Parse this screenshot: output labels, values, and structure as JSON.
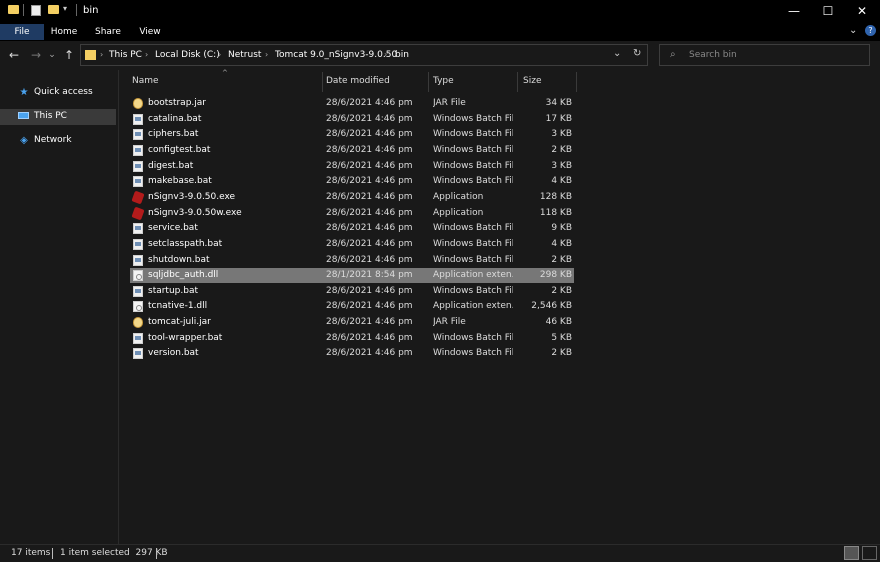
{
  "window": {
    "title": "bin",
    "min_glyph": "—",
    "max_glyph": "☐",
    "close_glyph": "✕"
  },
  "ribbon": {
    "tabs": [
      "File",
      "Home",
      "Share",
      "View"
    ],
    "expand_glyph": "⌄",
    "help_glyph": "?"
  },
  "address": {
    "crumbs": [
      "This PC",
      "Local Disk (C:)",
      "Netrust",
      "Tomcat 9.0_nSignv3-9.0.50",
      "bin"
    ],
    "separator": "›"
  },
  "search": {
    "placeholder": "Search bin"
  },
  "nav": {
    "back": "←",
    "forward": "→",
    "recent": "⌄",
    "up": "↑",
    "refresh": "↻",
    "dropdown": "⌄",
    "items": [
      {
        "label": "Quick access",
        "icon": "star-icon",
        "selected": false
      },
      {
        "label": "This PC",
        "icon": "computer-icon",
        "selected": true
      },
      {
        "label": "Network",
        "icon": "network-icon",
        "selected": false
      }
    ]
  },
  "columns": {
    "name": "Name",
    "date": "Date modified",
    "type": "Type",
    "size": "Size"
  },
  "files": [
    {
      "name": "bootstrap.jar",
      "date": "28/6/2021 4:46 pm",
      "type": "JAR File",
      "size": "34 KB",
      "icon": "jar"
    },
    {
      "name": "catalina.bat",
      "date": "28/6/2021 4:46 pm",
      "type": "Windows Batch File",
      "size": "17 KB",
      "icon": "bat"
    },
    {
      "name": "ciphers.bat",
      "date": "28/6/2021 4:46 pm",
      "type": "Windows Batch File",
      "size": "3 KB",
      "icon": "bat"
    },
    {
      "name": "configtest.bat",
      "date": "28/6/2021 4:46 pm",
      "type": "Windows Batch File",
      "size": "2 KB",
      "icon": "bat"
    },
    {
      "name": "digest.bat",
      "date": "28/6/2021 4:46 pm",
      "type": "Windows Batch File",
      "size": "3 KB",
      "icon": "bat"
    },
    {
      "name": "makebase.bat",
      "date": "28/6/2021 4:46 pm",
      "type": "Windows Batch File",
      "size": "4 KB",
      "icon": "bat"
    },
    {
      "name": "nSignv3-9.0.50.exe",
      "date": "28/6/2021 4:46 pm",
      "type": "Application",
      "size": "128 KB",
      "icon": "exe"
    },
    {
      "name": "nSignv3-9.0.50w.exe",
      "date": "28/6/2021 4:46 pm",
      "type": "Application",
      "size": "118 KB",
      "icon": "exe"
    },
    {
      "name": "service.bat",
      "date": "28/6/2021 4:46 pm",
      "type": "Windows Batch File",
      "size": "9 KB",
      "icon": "bat"
    },
    {
      "name": "setclasspath.bat",
      "date": "28/6/2021 4:46 pm",
      "type": "Windows Batch File",
      "size": "4 KB",
      "icon": "bat"
    },
    {
      "name": "shutdown.bat",
      "date": "28/6/2021 4:46 pm",
      "type": "Windows Batch File",
      "size": "2 KB",
      "icon": "bat"
    },
    {
      "name": "sqljdbc_auth.dll",
      "date": "28/1/2021 8:54 pm",
      "type": "Application exten...",
      "size": "298 KB",
      "icon": "dll",
      "selected": true
    },
    {
      "name": "startup.bat",
      "date": "28/6/2021 4:46 pm",
      "type": "Windows Batch File",
      "size": "2 KB",
      "icon": "bat"
    },
    {
      "name": "tcnative-1.dll",
      "date": "28/6/2021 4:46 pm",
      "type": "Application exten...",
      "size": "2,546 KB",
      "icon": "dll"
    },
    {
      "name": "tomcat-juli.jar",
      "date": "28/6/2021 4:46 pm",
      "type": "JAR File",
      "size": "46 KB",
      "icon": "jar"
    },
    {
      "name": "tool-wrapper.bat",
      "date": "28/6/2021 4:46 pm",
      "type": "Windows Batch File",
      "size": "5 KB",
      "icon": "bat"
    },
    {
      "name": "version.bat",
      "date": "28/6/2021 4:46 pm",
      "type": "Windows Batch File",
      "size": "2 KB",
      "icon": "bat"
    }
  ],
  "status": {
    "item_count": "17 items",
    "selection": "1 item selected  297 KB"
  },
  "colors": {
    "background": "#191919",
    "selected_row": "#777777",
    "folder": "#f4cf63",
    "file_tab": "#1f3b63"
  }
}
